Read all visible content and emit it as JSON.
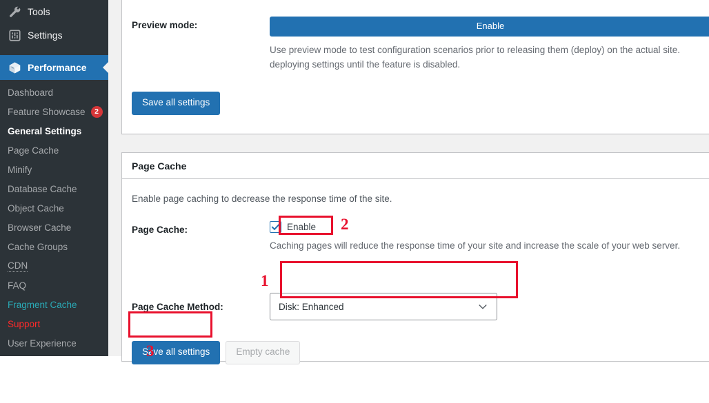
{
  "sidebar": {
    "top_items": [
      {
        "label": "Tools",
        "icon": "wrench-icon"
      },
      {
        "label": "Settings",
        "icon": "sliders-icon"
      }
    ],
    "active_item": {
      "label": "Performance",
      "icon": "cube-icon"
    },
    "submenu": [
      {
        "label": "Dashboard",
        "style": "normal",
        "badge": null
      },
      {
        "label": "Feature Showcase",
        "style": "normal",
        "badge": "2"
      },
      {
        "label": "General Settings",
        "style": "current",
        "badge": null
      },
      {
        "label": "Page Cache",
        "style": "normal",
        "badge": null
      },
      {
        "label": "Minify",
        "style": "normal",
        "badge": null
      },
      {
        "label": "Database Cache",
        "style": "normal",
        "badge": null
      },
      {
        "label": "Object Cache",
        "style": "normal",
        "badge": null
      },
      {
        "label": "Browser Cache",
        "style": "normal",
        "badge": null
      },
      {
        "label": "Cache Groups",
        "style": "normal",
        "badge": null
      },
      {
        "label": "CDN",
        "style": "dotted",
        "badge": null
      },
      {
        "label": "FAQ",
        "style": "normal",
        "badge": null
      },
      {
        "label": "Fragment Cache",
        "style": "teal",
        "badge": null
      },
      {
        "label": "Support",
        "style": "red",
        "badge": null
      },
      {
        "label": "User Experience",
        "style": "normal",
        "badge": null
      }
    ]
  },
  "preview_panel": {
    "label": "Preview mode:",
    "enable_button": "Enable",
    "help_line1": "Use preview mode to test configuration scenarios prior to releasing them (deploy) on the actual site.",
    "help_line2": "deploying settings until the feature is disabled.",
    "save_button": "Save all settings"
  },
  "page_cache_panel": {
    "title": "Page Cache",
    "intro": "Enable page caching to decrease the response time of the site.",
    "enable_row": {
      "label": "Page Cache:",
      "checkbox_label": "Enable",
      "checked": true,
      "help": "Caching pages will reduce the response time of your site and increase the scale of your web server."
    },
    "method_row": {
      "label": "Page Cache Method:",
      "selected": "Disk: Enhanced"
    },
    "save_button": "Save all settings",
    "empty_cache_button": "Empty cache"
  },
  "annotations": {
    "markers": [
      {
        "number": "1",
        "target": "page-cache-method-select"
      },
      {
        "number": "2",
        "target": "page-cache-enable-checkbox"
      },
      {
        "number": "3",
        "target": "page-cache-save-button"
      }
    ],
    "color": "#e8112d"
  }
}
